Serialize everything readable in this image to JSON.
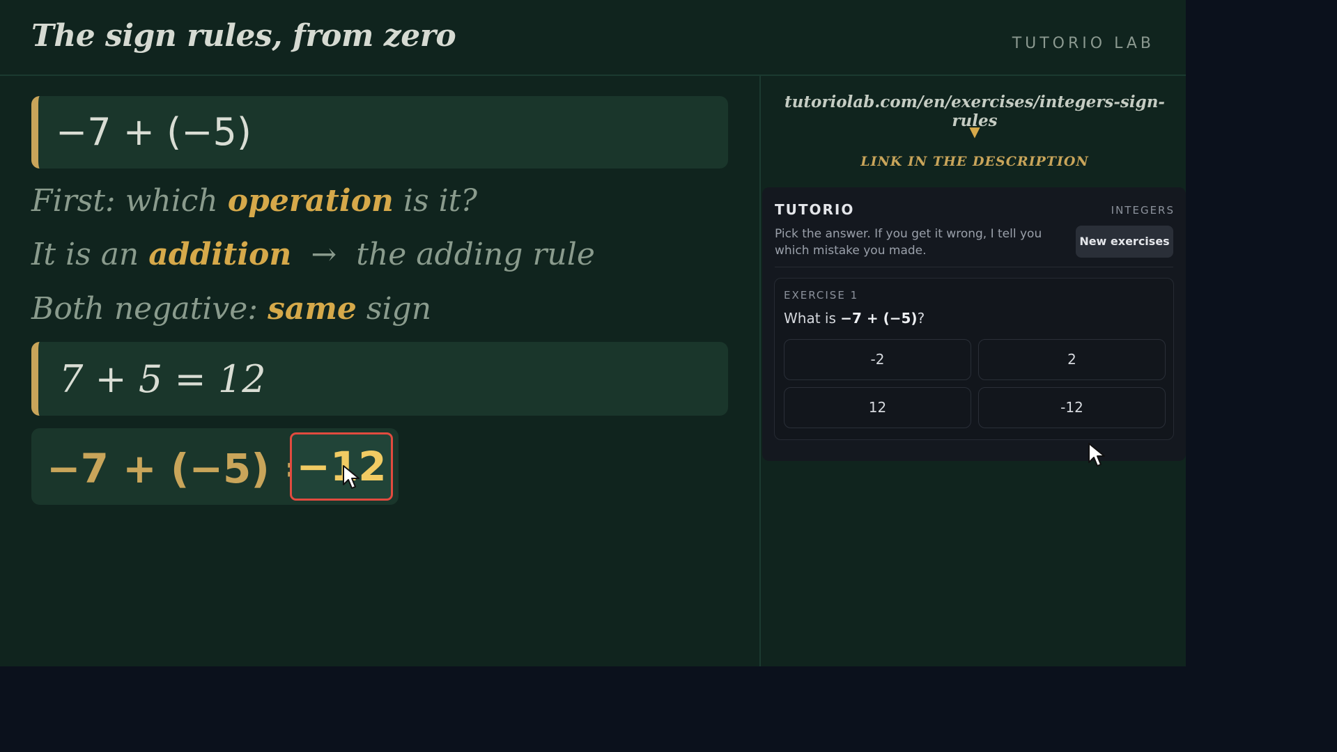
{
  "header": {
    "title": "The sign rules, from zero",
    "brand": "TUTORIO LAB"
  },
  "board": {
    "expression": "−7 + (−5)",
    "step1": {
      "before": "First: which ",
      "highlight": "operation",
      "after": " is it?"
    },
    "step2": {
      "before": "It is an ",
      "highlight": "addition",
      "after": "  →  the adding rule"
    },
    "step3": {
      "before": "Both negative: ",
      "highlight": "same",
      "after": " sign"
    },
    "sum": "7 + 5 = 12",
    "answer_expression": "−7 + (−5) =",
    "answer_result": "−12"
  },
  "link": {
    "url": "tutoriolab.com/en/exercises/integers-sign-rules",
    "arrow": "▼",
    "caption": "LINK IN THE DESCRIPTION"
  },
  "widget": {
    "brand": "TUTORIO",
    "topic": "INTEGERS",
    "description": "Pick the answer. If you get it wrong, I tell you which mistake you made.",
    "new_button": "New exercises",
    "exercise": {
      "label": "EXERCISE 1",
      "question_prefix": "What is ",
      "question_expr": "−7 + (−5)",
      "question_suffix": "?",
      "options": [
        "-2",
        "2",
        "12",
        "-12"
      ]
    }
  },
  "colors": {
    "board_bg": "#10241e",
    "highlight": "#d6a94a",
    "answer_border": "#e24b3f",
    "page_bg": "#0b111c"
  },
  "icons": [
    "mouse-cursor-icon",
    "down-arrow-icon"
  ]
}
